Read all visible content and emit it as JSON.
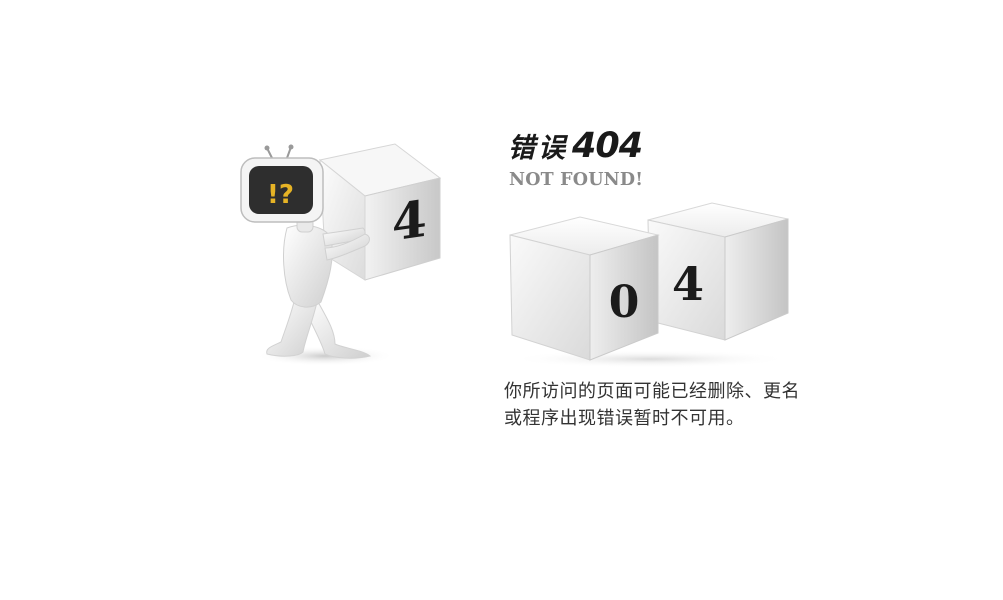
{
  "error": {
    "title_cn": "错误",
    "title_code": "404",
    "subtitle": "NOT FOUND!",
    "box_carried_digit": "4",
    "cube_left_digit": "0",
    "cube_right_digit": "4",
    "monitor_symbol": "!?",
    "message_line1": "你所访问的页面可能已经删除、更名",
    "message_line2": "或程序出现错误暂时不可用。"
  },
  "colors": {
    "background": "#ffffff",
    "title": "#1a1a1a",
    "subtitle": "#8a8a8a",
    "message": "#333333",
    "monitor_screen": "#2e2e2e",
    "monitor_symbol": "#e6b325"
  },
  "icons": {
    "illustration": "figure-carrying-cube-illustration",
    "cubes": "zero-four-cubes-illustration"
  }
}
